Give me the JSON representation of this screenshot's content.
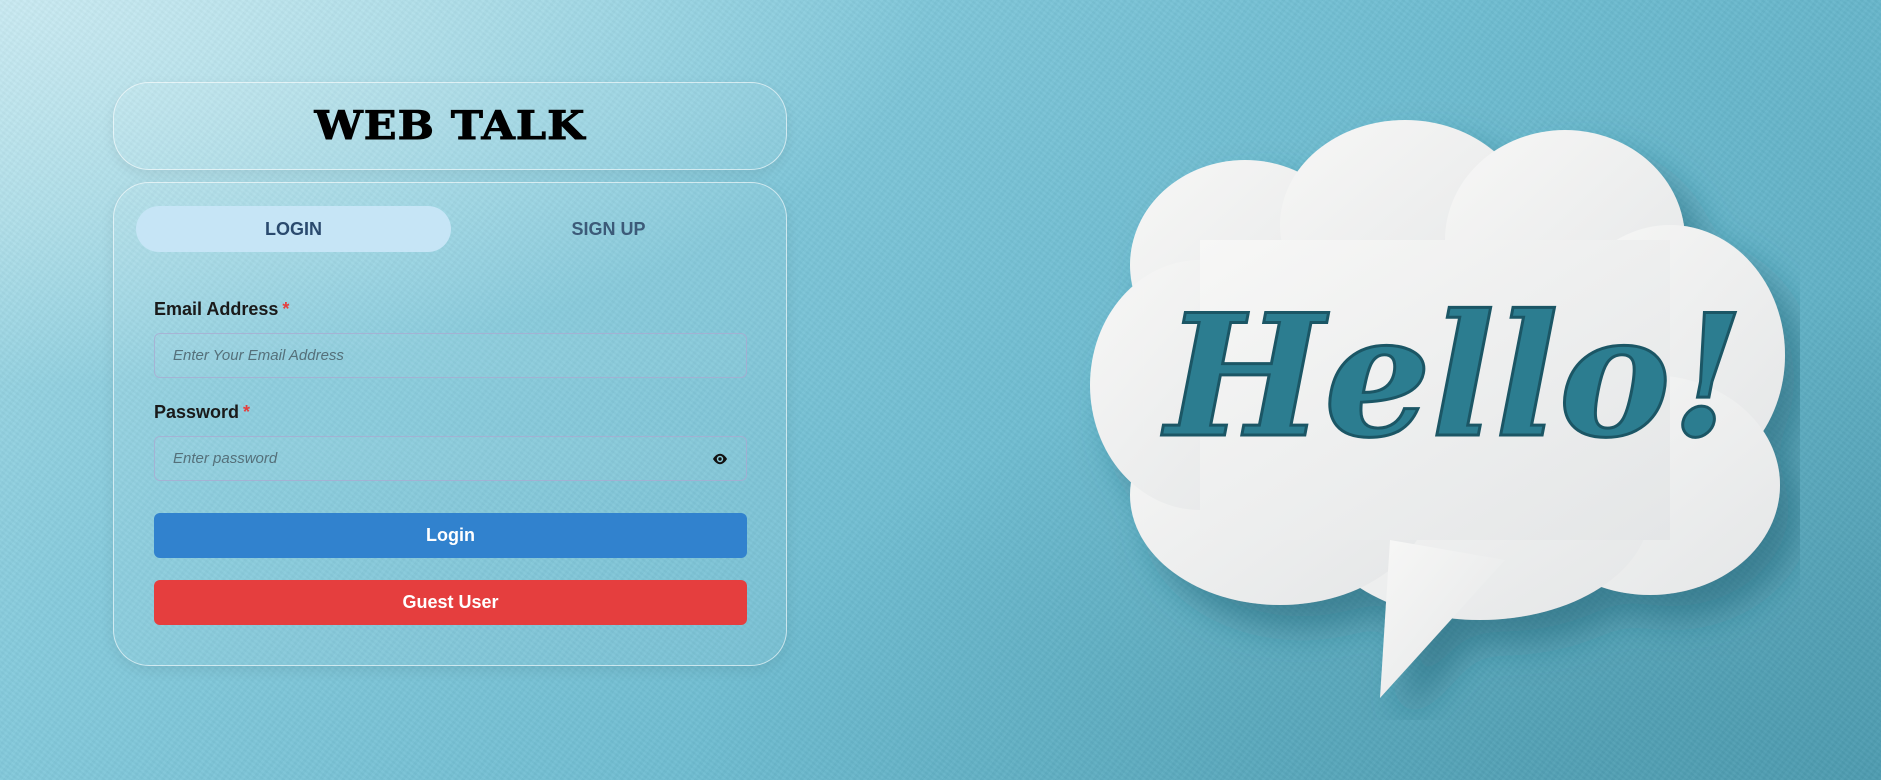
{
  "app": {
    "title": "WEB TALK"
  },
  "tabs": [
    {
      "label": "LOGIN",
      "active": true
    },
    {
      "label": "SIGN UP",
      "active": false
    }
  ],
  "form": {
    "email_label": "Email Address",
    "email_required": "*",
    "email_placeholder": "Enter Your Email Address",
    "email_value": "",
    "password_label": "Password",
    "password_required": "*",
    "password_placeholder": "Enter password",
    "password_value": "",
    "password_toggle_icon": "eye-icon"
  },
  "buttons": {
    "login_label": "Login",
    "guest_label": "Guest User"
  },
  "hero": {
    "text": "Hello!",
    "icon": "speech-bubble"
  },
  "colors": {
    "login_button": "#3182ce",
    "guest_button": "#e53e3e",
    "active_tab": "#c6e5f6",
    "required_mark": "#e53e3e"
  }
}
